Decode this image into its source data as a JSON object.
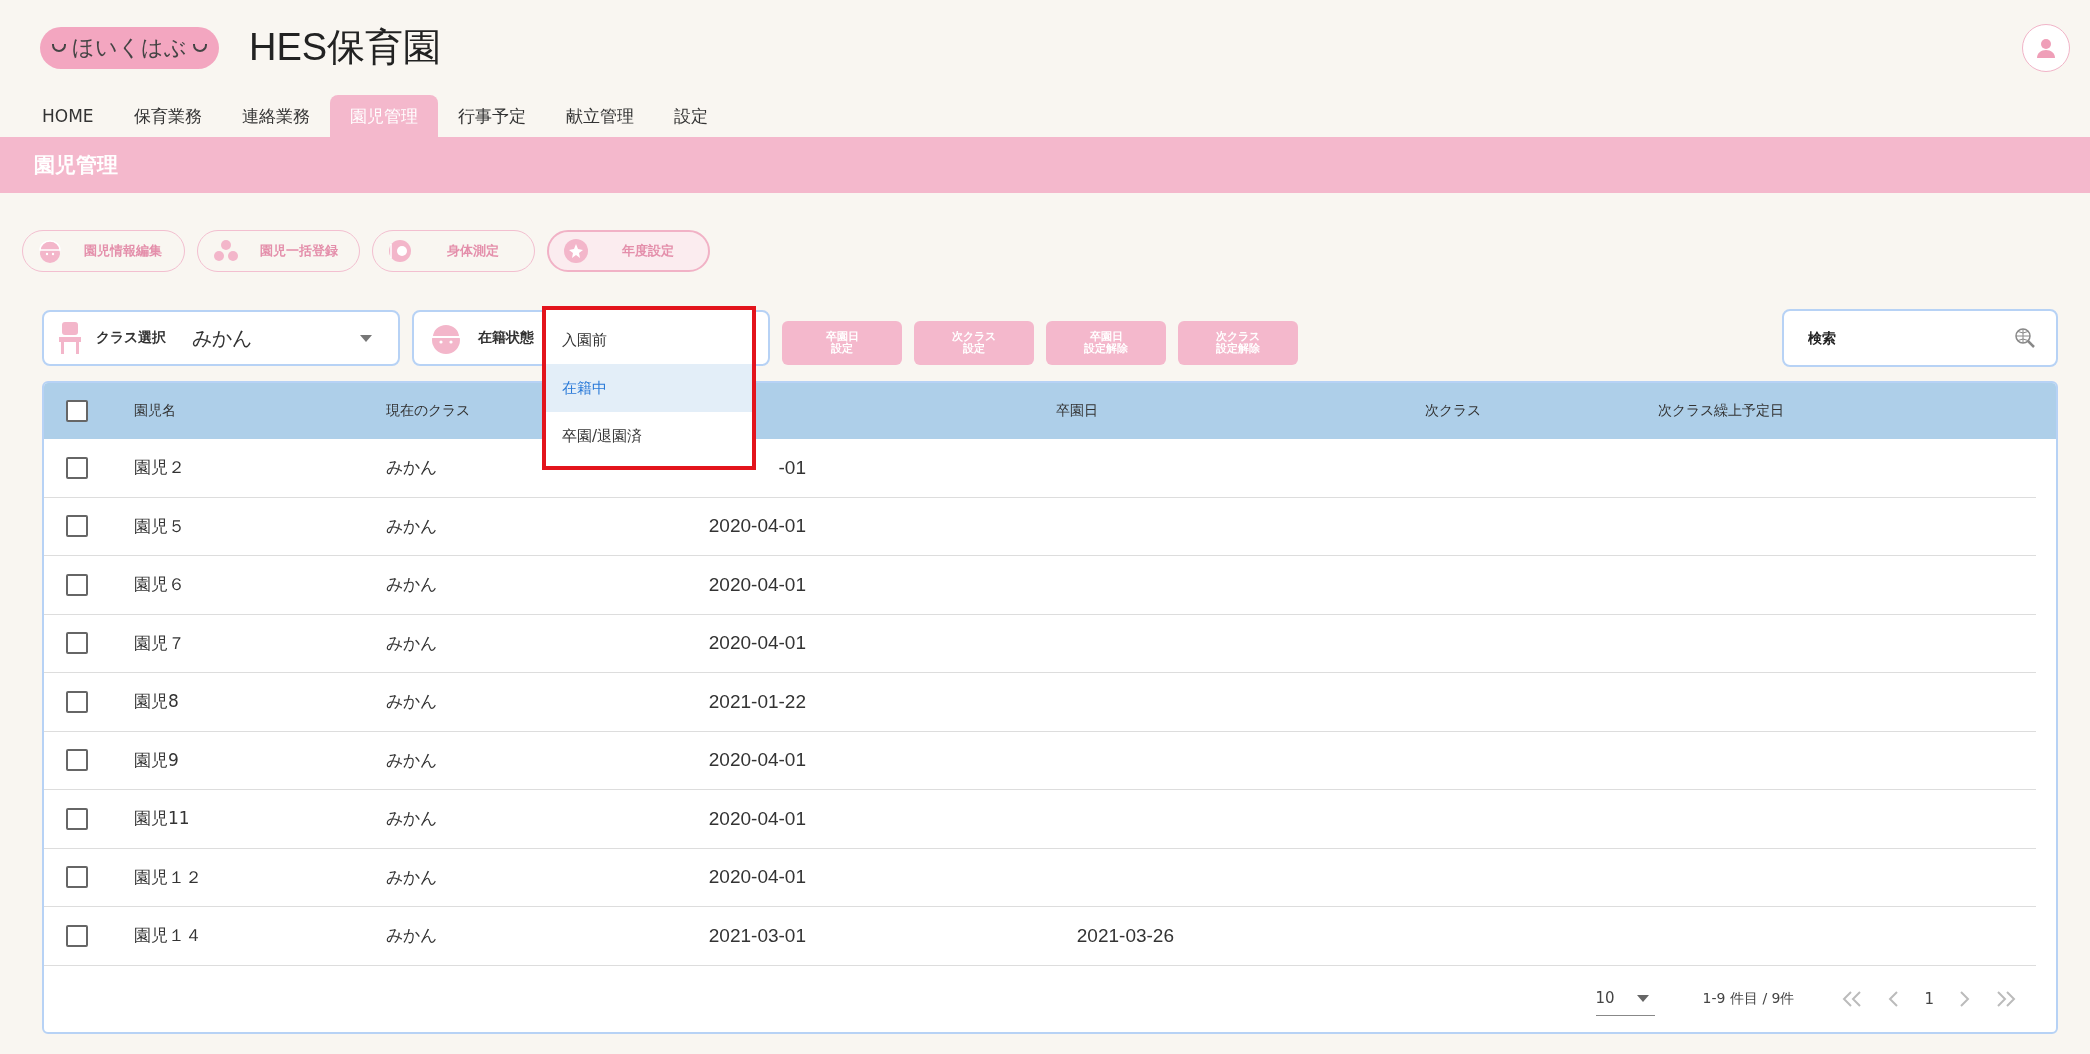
{
  "logo": {
    "text": "ほいくはぶ"
  },
  "app_title": "HES保育園",
  "nav_tabs": [
    {
      "label": "HOME",
      "selected": false
    },
    {
      "label": "保育業務",
      "selected": false
    },
    {
      "label": "連絡業務",
      "selected": false
    },
    {
      "label": "園児管理",
      "selected": true
    },
    {
      "label": "行事予定",
      "selected": false
    },
    {
      "label": "献立管理",
      "selected": false
    },
    {
      "label": "設定",
      "selected": false
    }
  ],
  "page_title": "園児管理",
  "action_buttons": [
    {
      "label": "園児情報編集",
      "kind": "helmet",
      "selected": false
    },
    {
      "label": "園児一括登録",
      "kind": "group",
      "selected": false
    },
    {
      "label": "身体測定",
      "kind": "ruler",
      "selected": false
    },
    {
      "label": "年度設定",
      "kind": "flower",
      "selected": true
    }
  ],
  "class_select": {
    "label": "クラス選択",
    "value": "みかん"
  },
  "status_select": {
    "label": "在籍状態",
    "expanded": true,
    "options": [
      {
        "label": "入園前",
        "selected": false
      },
      {
        "label": "在籍中",
        "selected": true
      },
      {
        "label": "卒園/退園済",
        "selected": false
      }
    ]
  },
  "bulk_buttons": [
    {
      "lines": [
        "卒園日",
        "設定"
      ]
    },
    {
      "lines": [
        "次クラス",
        "設定"
      ]
    },
    {
      "lines": [
        "卒園日",
        "設定解除"
      ]
    },
    {
      "lines": [
        "次クラス",
        "設定解除"
      ]
    }
  ],
  "search": {
    "placeholder": "検索"
  },
  "table": {
    "header_checked": false,
    "columns": [
      "園児名",
      "現在のクラス",
      "卒園日",
      "次クラス",
      "次クラス繰上予定日"
    ],
    "rows": [
      {
        "checked": false,
        "name": "園児２",
        "class": "みかん",
        "column_3": "-01"
      },
      {
        "checked": false,
        "name": "園児５",
        "class": "みかん",
        "column_3": "2020-04-01"
      },
      {
        "checked": false,
        "name": "園児６",
        "class": "みかん",
        "column_3": "2020-04-01"
      },
      {
        "checked": false,
        "name": "園児７",
        "class": "みかん",
        "column_3": "2020-04-01"
      },
      {
        "checked": false,
        "name": "園児8",
        "class": "みかん",
        "column_3": "2021-01-22"
      },
      {
        "checked": false,
        "name": "園児9",
        "class": "みかん",
        "column_3": "2020-04-01"
      },
      {
        "checked": false,
        "name": "園児11",
        "class": "みかん",
        "column_3": "2020-04-01"
      },
      {
        "checked": false,
        "name": "園児１２",
        "class": "みかん",
        "column_3": "2020-04-01"
      },
      {
        "checked": false,
        "name": "園児１４",
        "class": "みかん",
        "column_3": "2021-03-01",
        "graduation": "2021-03-26"
      }
    ]
  },
  "pagination": {
    "page_size": "10",
    "range": "1-9 件目 / 9件",
    "page": "1"
  }
}
